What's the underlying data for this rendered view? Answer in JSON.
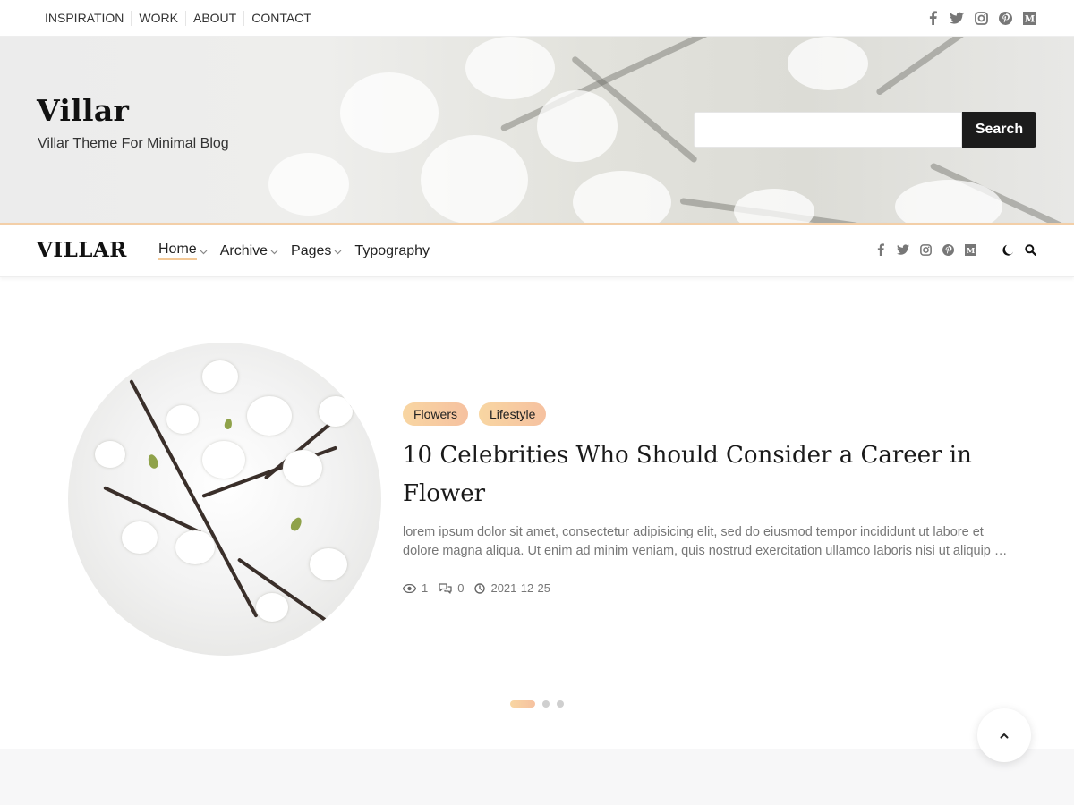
{
  "topbar": {
    "links": [
      "INSPIRATION",
      "WORK",
      "ABOUT",
      "CONTACT"
    ],
    "social_icons": [
      "facebook-icon",
      "twitter-icon",
      "instagram-icon",
      "pinterest-icon",
      "medium-icon"
    ]
  },
  "hero": {
    "site_title": "Villar",
    "tagline": "Villar Theme For Minimal Blog",
    "search_placeholder": "",
    "search_button": "Search"
  },
  "nav": {
    "logo": "VILLAR",
    "items": [
      {
        "label": "Home",
        "has_dropdown": true,
        "active": true
      },
      {
        "label": "Archive",
        "has_dropdown": true,
        "active": false
      },
      {
        "label": "Pages",
        "has_dropdown": true,
        "active": false
      },
      {
        "label": "Typography",
        "has_dropdown": false,
        "active": false
      }
    ],
    "social_icons": [
      "facebook-icon",
      "twitter-icon",
      "instagram-icon",
      "pinterest-icon",
      "medium-icon"
    ],
    "tools": [
      "dark-mode-moon-icon",
      "search-icon"
    ]
  },
  "featured": {
    "tags": [
      "Flowers",
      "Lifestyle"
    ],
    "title": "10 Celebrities Who Should Consider a Career in Flower",
    "excerpt_line1": "lorem ipsum dolor sit amet, consectetur adipisicing elit, sed do eiusmod tempor incididunt ut labore et",
    "excerpt_line2": "dolore magna aliqua. Ut enim ad minim veniam, quis nostrud exercitation ullamco laboris nisi ut aliquip ex ea commodo consequat.",
    "views": "1",
    "comments": "0",
    "date": "2021-12-25"
  },
  "slider": {
    "total": 3,
    "active_index": 0
  },
  "colors": {
    "accent_gradient_start": "#f8d6a2",
    "accent_gradient_end": "#f6c1a0",
    "button_dark": "#1c1c1c"
  }
}
